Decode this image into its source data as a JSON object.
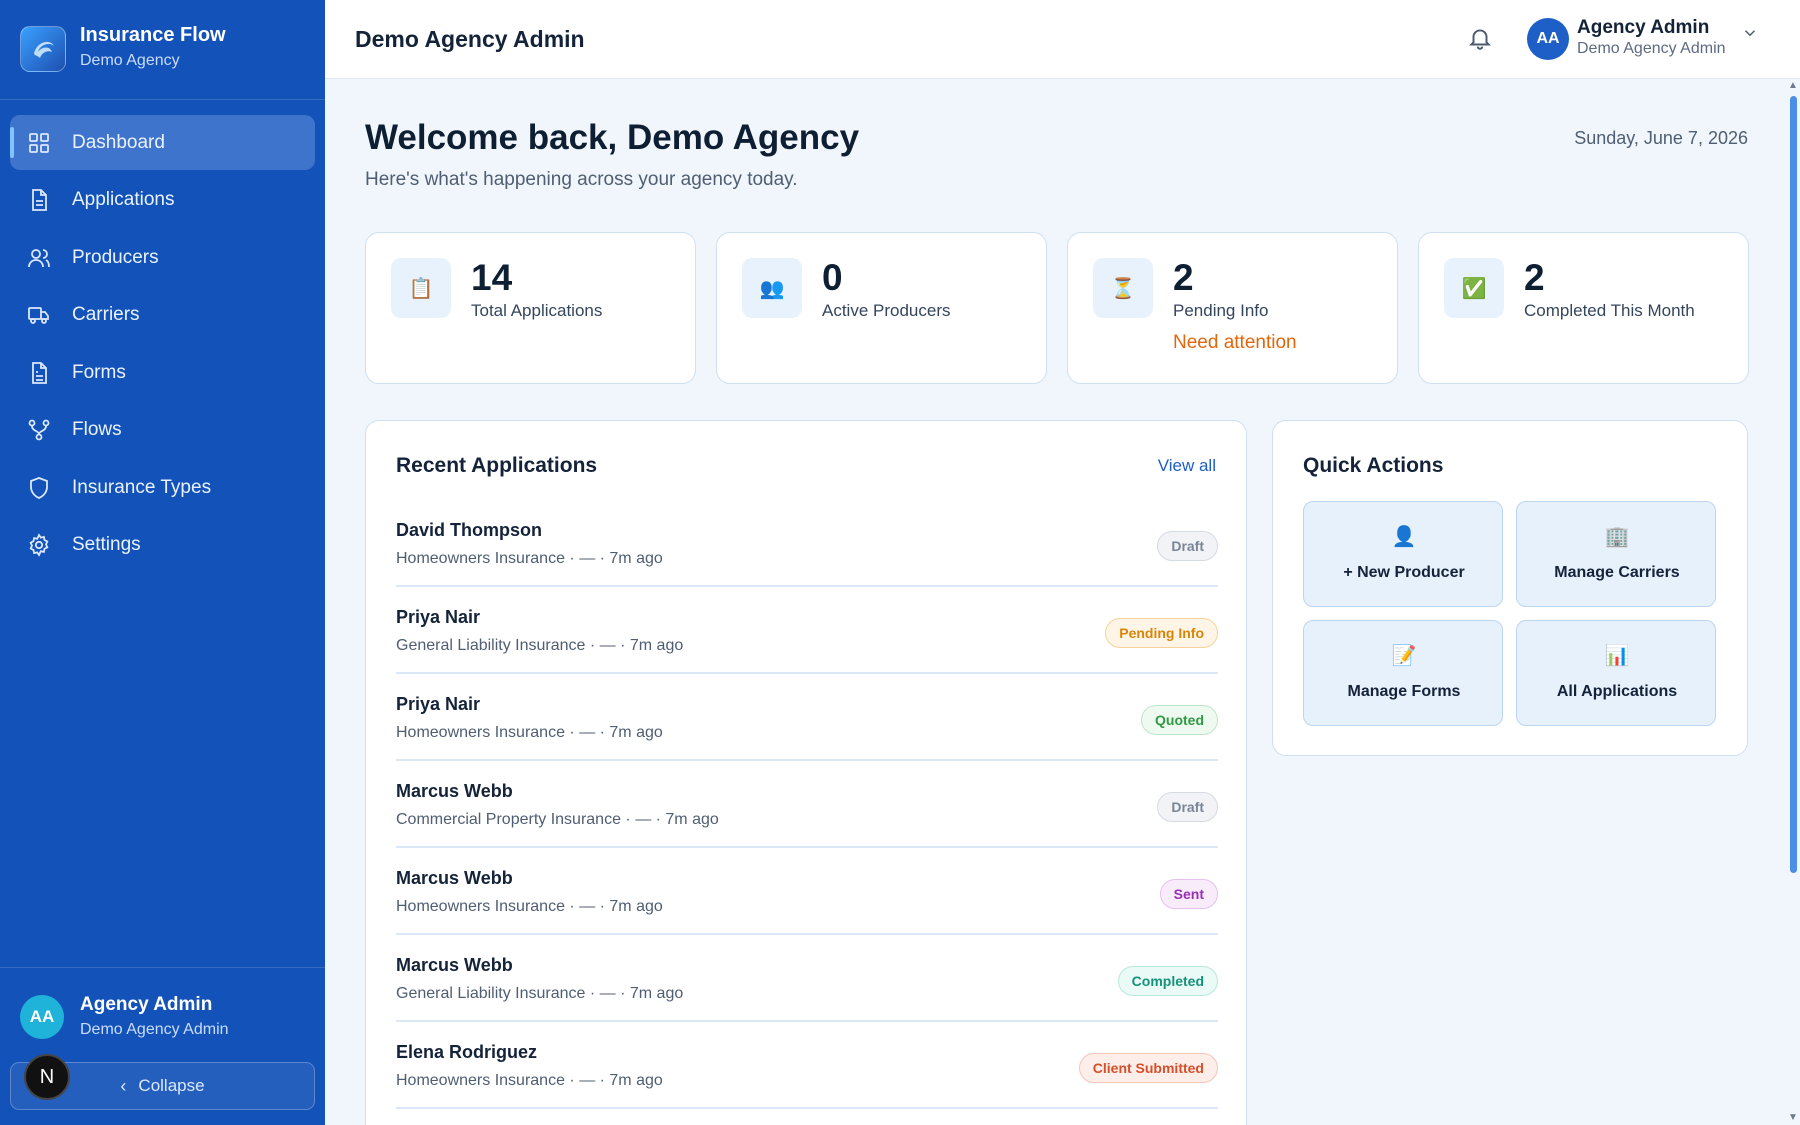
{
  "brand": {
    "title": "Insurance Flow",
    "subtitle": "Demo Agency"
  },
  "nav": [
    {
      "label": "Dashboard",
      "icon": "grid-icon",
      "active": true
    },
    {
      "label": "Applications",
      "icon": "document-icon"
    },
    {
      "label": "Producers",
      "icon": "users-icon"
    },
    {
      "label": "Carriers",
      "icon": "truck-icon"
    },
    {
      "label": "Forms",
      "icon": "form-icon"
    },
    {
      "label": "Flows",
      "icon": "flow-icon"
    },
    {
      "label": "Insurance Types",
      "icon": "shield-icon"
    },
    {
      "label": "Settings",
      "icon": "gear-icon"
    }
  ],
  "sidebar_user": {
    "initials": "AA",
    "name": "Agency Admin",
    "role": "Demo Agency Admin"
  },
  "collapse_label": "Collapse",
  "n_badge": "N",
  "topbar": {
    "title": "Demo Agency Admin",
    "user": {
      "initials": "AA",
      "name": "Agency Admin",
      "role": "Demo Agency Admin"
    }
  },
  "welcome": {
    "title": "Welcome back, Demo Agency",
    "subtitle": "Here's what's happening across your agency today.",
    "date": "Sunday, June 7, 2026"
  },
  "stats": [
    {
      "value": "14",
      "label": "Total Applications",
      "icon": "📋"
    },
    {
      "value": "0",
      "label": "Active Producers",
      "icon": "👥"
    },
    {
      "value": "2",
      "label": "Pending Info",
      "icon": "⏳",
      "note": "Need attention"
    },
    {
      "value": "2",
      "label": "Completed This Month",
      "icon": "✅"
    }
  ],
  "recent": {
    "title": "Recent Applications",
    "view_all": "View all",
    "rows": [
      {
        "name": "David Thompson",
        "meta": "Homeowners Insurance · — · 7m ago",
        "status": "Draft",
        "kind": "draft"
      },
      {
        "name": "Priya Nair",
        "meta": "General Liability Insurance · — · 7m ago",
        "status": "Pending Info",
        "kind": "pending"
      },
      {
        "name": "Priya Nair",
        "meta": "Homeowners Insurance · — · 7m ago",
        "status": "Quoted",
        "kind": "quoted"
      },
      {
        "name": "Marcus Webb",
        "meta": "Commercial Property Insurance · — · 7m ago",
        "status": "Draft",
        "kind": "draft"
      },
      {
        "name": "Marcus Webb",
        "meta": "Homeowners Insurance · — · 7m ago",
        "status": "Sent",
        "kind": "sent"
      },
      {
        "name": "Marcus Webb",
        "meta": "General Liability Insurance · — · 7m ago",
        "status": "Completed",
        "kind": "completed"
      },
      {
        "name": "Elena Rodriguez",
        "meta": "Homeowners Insurance · — · 7m ago",
        "status": "Client Submitted",
        "kind": "client"
      }
    ]
  },
  "quick": {
    "title": "Quick Actions",
    "actions": [
      {
        "label": "+ New Producer",
        "icon": "👤"
      },
      {
        "label": "Manage Carriers",
        "icon": "🏢"
      },
      {
        "label": "Manage Forms",
        "icon": "📝"
      },
      {
        "label": "All Applications",
        "icon": "📊"
      }
    ]
  }
}
